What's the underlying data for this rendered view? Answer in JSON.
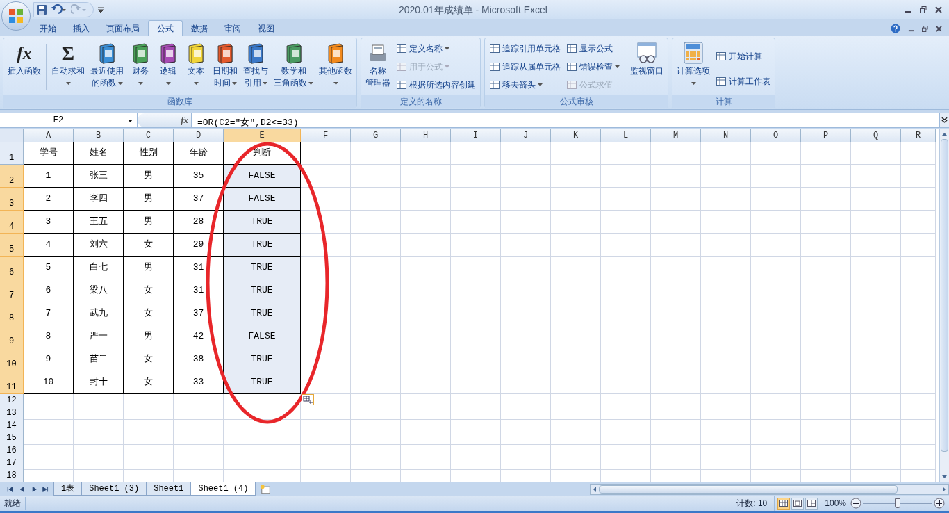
{
  "window": {
    "title": "2020.01年成绩单 - Microsoft Excel"
  },
  "ribbon_tabs": [
    {
      "label": "开始",
      "selected": false
    },
    {
      "label": "插入",
      "selected": false
    },
    {
      "label": "页面布局",
      "selected": false
    },
    {
      "label": "公式",
      "selected": true
    },
    {
      "label": "数据",
      "selected": false
    },
    {
      "label": "审阅",
      "selected": false
    },
    {
      "label": "视图",
      "selected": false
    }
  ],
  "ribbon_groups": [
    {
      "title": "函数库",
      "items": [
        {
          "kind": "large",
          "glyph": "fx",
          "lines": [
            "插入函数"
          ],
          "dropdown": false
        },
        {
          "kind": "separator"
        },
        {
          "kind": "large",
          "glyph": "Σ",
          "lines": [
            "自动求和"
          ],
          "dropdown": true
        },
        {
          "kind": "large",
          "lines": [
            "最近使用",
            "的函数"
          ],
          "dropdown": true
        },
        {
          "kind": "large",
          "lines": [
            "财务"
          ],
          "dropdown": true
        },
        {
          "kind": "large",
          "lines": [
            "逻辑"
          ],
          "dropdown": true
        },
        {
          "kind": "large",
          "lines": [
            "文本"
          ],
          "dropdown": true
        },
        {
          "kind": "large",
          "lines": [
            "日期和",
            "时间"
          ],
          "dropdown": true
        },
        {
          "kind": "large",
          "lines": [
            "查找与",
            "引用"
          ],
          "dropdown": true
        },
        {
          "kind": "large",
          "lines": [
            "数学和",
            "三角函数"
          ],
          "dropdown": true
        },
        {
          "kind": "large",
          "lines": [
            "其他函数"
          ],
          "dropdown": true
        }
      ]
    },
    {
      "title": "定义的名称",
      "items": [
        {
          "kind": "large",
          "lines": [
            "名称",
            "管理器"
          ],
          "dropdown": false
        },
        {
          "kind": "column",
          "items": [
            {
              "label": "定义名称",
              "dropdown": true,
              "disabled": false
            },
            {
              "label": "用于公式",
              "dropdown": true,
              "disabled": true
            },
            {
              "label": "根据所选内容创建",
              "dropdown": false,
              "disabled": false
            }
          ]
        }
      ]
    },
    {
      "title": "公式审核",
      "items": [
        {
          "kind": "column",
          "items": [
            {
              "label": "追踪引用单元格",
              "dropdown": false,
              "disabled": false
            },
            {
              "label": "追踪从属单元格",
              "dropdown": false,
              "disabled": false
            },
            {
              "label": "移去箭头",
              "dropdown": true,
              "disabled": false
            }
          ]
        },
        {
          "kind": "column",
          "items": [
            {
              "label": "显示公式",
              "dropdown": false,
              "disabled": false
            },
            {
              "label": "错误检查",
              "dropdown": true,
              "disabled": false
            },
            {
              "label": "公式求值",
              "dropdown": false,
              "disabled": true
            }
          ]
        },
        {
          "kind": "separator"
        },
        {
          "kind": "large",
          "lines": [
            "监视窗口"
          ],
          "dropdown": false
        }
      ]
    },
    {
      "title": "计算",
      "items": [
        {
          "kind": "large",
          "lines": [
            "计算选项"
          ],
          "dropdown": true
        },
        {
          "kind": "column",
          "items": [
            {
              "label": "开始计算",
              "dropdown": false,
              "disabled": false
            },
            {
              "label": "计算工作表",
              "dropdown": false,
              "disabled": false
            }
          ]
        }
      ]
    }
  ],
  "formula_bar": {
    "name_box": "E2",
    "fx_label": "fx",
    "formula": "=OR(C2=″女″,D2<=33)"
  },
  "columns": [
    {
      "label": "A",
      "selected": false
    },
    {
      "label": "B",
      "selected": false
    },
    {
      "label": "C",
      "selected": false
    },
    {
      "label": "D",
      "selected": false
    },
    {
      "label": "E",
      "selected": true
    },
    {
      "label": "F",
      "selected": false
    },
    {
      "label": "G",
      "selected": false
    },
    {
      "label": "H",
      "selected": false
    },
    {
      "label": "I",
      "selected": false
    },
    {
      "label": "J",
      "selected": false
    },
    {
      "label": "K",
      "selected": false
    },
    {
      "label": "L",
      "selected": false
    },
    {
      "label": "M",
      "selected": false
    },
    {
      "label": "N",
      "selected": false
    },
    {
      "label": "O",
      "selected": false
    },
    {
      "label": "P",
      "selected": false
    },
    {
      "label": "Q",
      "selected": false
    },
    {
      "label": "R",
      "selected": false
    }
  ],
  "rows": [
    {
      "number": "1",
      "selected": false,
      "cells": [
        "学号",
        "姓名",
        "性别",
        "年龄",
        "判断"
      ]
    },
    {
      "number": "2",
      "selected": true,
      "cells": [
        "1",
        "张三",
        "男",
        "35",
        "FALSE"
      ]
    },
    {
      "number": "3",
      "selected": true,
      "cells": [
        "2",
        "李四",
        "男",
        "37",
        "FALSE"
      ]
    },
    {
      "number": "4",
      "selected": true,
      "cells": [
        "3",
        "王五",
        "男",
        "28",
        "TRUE"
      ]
    },
    {
      "number": "5",
      "selected": true,
      "cells": [
        "4",
        "刘六",
        "女",
        "29",
        "TRUE"
      ]
    },
    {
      "number": "6",
      "selected": true,
      "cells": [
        "5",
        "白七",
        "男",
        "31",
        "TRUE"
      ]
    },
    {
      "number": "7",
      "selected": true,
      "cells": [
        "6",
        "梁八",
        "女",
        "31",
        "TRUE"
      ]
    },
    {
      "number": "8",
      "selected": true,
      "cells": [
        "7",
        "武九",
        "女",
        "37",
        "TRUE"
      ]
    },
    {
      "number": "9",
      "selected": true,
      "cells": [
        "8",
        "严一",
        "男",
        "42",
        "FALSE"
      ]
    },
    {
      "number": "10",
      "selected": true,
      "cells": [
        "9",
        "苗二",
        "女",
        "38",
        "TRUE"
      ]
    },
    {
      "number": "11",
      "selected": true,
      "cells": [
        "10",
        "封十",
        "女",
        "33",
        "TRUE"
      ]
    },
    {
      "number": "12",
      "selected": false
    },
    {
      "number": "13",
      "selected": false
    },
    {
      "number": "14",
      "selected": false
    },
    {
      "number": "15",
      "selected": false
    },
    {
      "number": "16",
      "selected": false
    },
    {
      "number": "17",
      "selected": false
    },
    {
      "number": "18",
      "selected": false
    }
  ],
  "sheet_tabs": [
    {
      "label": "1表",
      "selected": false
    },
    {
      "label": "Sheet1 (3)",
      "selected": false
    },
    {
      "label": "Sheet1",
      "selected": false
    },
    {
      "label": "Sheet1 (4)",
      "selected": true
    }
  ],
  "status_bar": {
    "ready": "就绪",
    "count": "计数: 10",
    "views": [
      {
        "selected": true
      },
      {
        "selected": false
      },
      {
        "selected": false
      }
    ],
    "zoom": "100%",
    "zoom_slider": {
      "level": 0.5
    }
  }
}
